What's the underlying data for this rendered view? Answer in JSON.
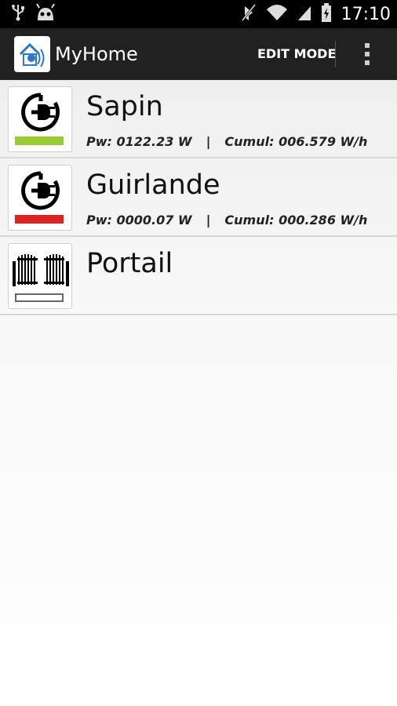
{
  "status_bar": {
    "time": "17:10",
    "icons": [
      "usb-icon",
      "android-debug-icon",
      "no-sync-icon",
      "wifi-icon",
      "signal-icon",
      "battery-charging-icon"
    ]
  },
  "action_bar": {
    "title": "MyHome",
    "edit_mode_label": "EDIT MODE",
    "overflow_icon": "more-vert-icon"
  },
  "devices": [
    {
      "name": "Sapin",
      "icon": "power-plug-icon",
      "status_color": "#99cc33",
      "power": "Pw: 0122.23 W",
      "separator": "|",
      "cumul": "Cumul: 006.579 W/h"
    },
    {
      "name": "Guirlande",
      "icon": "power-plug-icon",
      "status_color": "#dd2222",
      "power": "Pw: 0000.07 W",
      "separator": "|",
      "cumul": "Cumul: 000.286 W/h"
    },
    {
      "name": "Portail",
      "icon": "gate-icon",
      "status_color": "#ffffff"
    }
  ]
}
